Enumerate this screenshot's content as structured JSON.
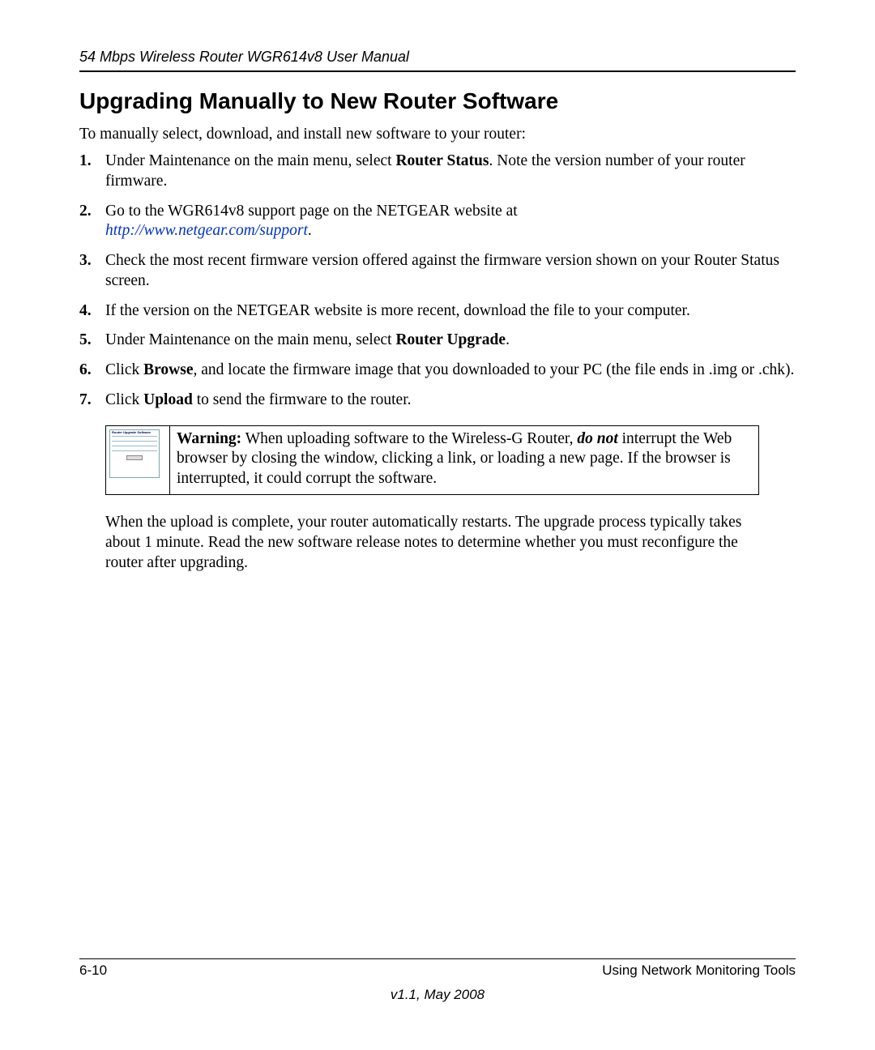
{
  "header": {
    "running_title": "54 Mbps Wireless Router WGR614v8 User Manual"
  },
  "section": {
    "title": "Upgrading Manually to New Router Software",
    "intro": "To manually select, download, and install new software to your router:"
  },
  "steps": {
    "s1_num": "1.",
    "s1_a": "Under Maintenance on the main menu, select ",
    "s1_bold": "Router Status",
    "s1_b": ". Note the version number of your router firmware.",
    "s2_num": "2.",
    "s2_a": "Go to the WGR614v8 support page on the NETGEAR website at ",
    "s2_link": "http://www.netgear.com/support",
    "s2_b": ".",
    "s3_num": "3.",
    "s3_a": "Check the most recent firmware version offered against the firmware version shown on your Router Status screen.",
    "s4_num": "4.",
    "s4_a": "If the version on the NETGEAR website is more recent, download the file to your computer.",
    "s5_num": "5.",
    "s5_a": "Under Maintenance on the main menu, select ",
    "s5_bold": "Router Upgrade",
    "s5_b": ".",
    "s6_num": "6.",
    "s6_a": "Click ",
    "s6_bold": "Browse",
    "s6_b": ", and locate the firmware image that you downloaded to your PC (the file ends in .img or .chk).",
    "s7_num": "7.",
    "s7_a": "Click ",
    "s7_bold": "Upload",
    "s7_b": " to send the firmware to the router."
  },
  "warning": {
    "label": "Warning:",
    "a": " When uploading software to the Wireless-G Router, ",
    "donot": "do not",
    "b": " interrupt the Web browser by closing the window, clicking a link, or loading a new page. If the browser is interrupted, it could corrupt the software."
  },
  "after_warning": "When the upload is complete, your router automatically restarts. The upgrade process typically takes about 1 minute. Read the new software release notes to determine whether you must reconfigure the router after upgrading.",
  "footer": {
    "page_num": "6-10",
    "chapter": "Using Network Monitoring Tools",
    "version": "v1.1, May 2008"
  }
}
